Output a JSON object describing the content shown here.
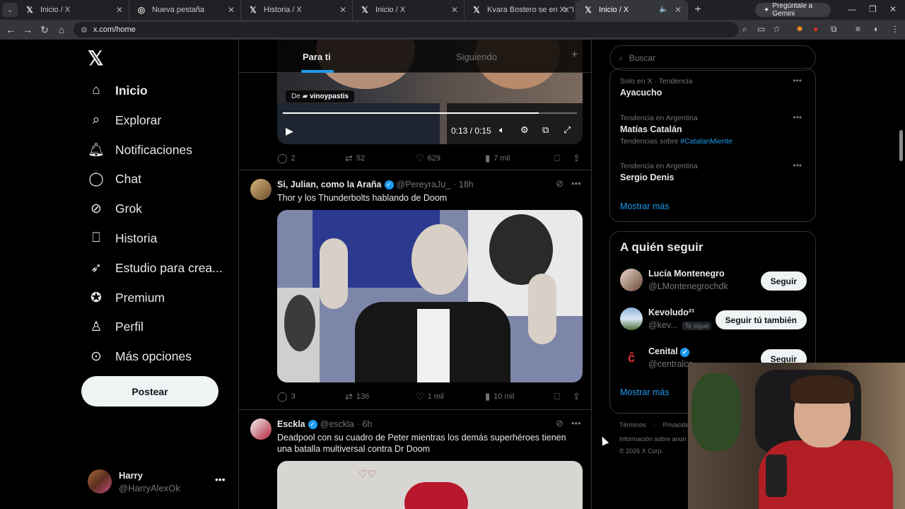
{
  "browser": {
    "tabs": [
      {
        "title": "Inicio / X",
        "favicon": "x-icon"
      },
      {
        "title": "Nueva pestaña",
        "favicon": "chrome-icon"
      },
      {
        "title": "Historia / X",
        "favicon": "x-icon"
      },
      {
        "title": "Inicio / X",
        "favicon": "x-icon"
      },
      {
        "title": "Kvara Bostero se en X: \"Doom d",
        "favicon": "x-icon"
      },
      {
        "title": "Inicio / X",
        "favicon": "x-icon",
        "active": true
      }
    ],
    "gemini_label": "Pregúntale a Gemini",
    "url": "x.com/home"
  },
  "sidebar": {
    "items": [
      {
        "label": "Inicio",
        "icon": "home-icon",
        "active": true
      },
      {
        "label": "Explorar",
        "icon": "search-icon"
      },
      {
        "label": "Notificaciones",
        "icon": "bell-icon"
      },
      {
        "label": "Chat",
        "icon": "chat-icon"
      },
      {
        "label": "Grok",
        "icon": "grok-icon"
      },
      {
        "label": "Historia",
        "icon": "bookmark-icon"
      },
      {
        "label": "Estudio para crea...",
        "icon": "rocket-icon"
      },
      {
        "label": "Premium",
        "icon": "premium-icon"
      },
      {
        "label": "Perfil",
        "icon": "person-icon"
      },
      {
        "label": "Más opciones",
        "icon": "more-circle-icon"
      }
    ],
    "post_button": "Postear",
    "profile": {
      "name": "Harry",
      "handle": "@HarryAlexOk"
    }
  },
  "feed": {
    "tabs": [
      "Para ti",
      "Siguiendo"
    ],
    "video": {
      "via_prefix": "De",
      "via_user": "vinoypastis",
      "time": "0:13 / 0:15",
      "progress": 0.87
    },
    "tweet1_actions": {
      "replies": "2",
      "reposts": "52",
      "likes": "629",
      "views": "7 mil"
    },
    "tweet2": {
      "name": "Si, Julian, como la Araña",
      "handle": "@PereyraJu_",
      "time": "· 18h",
      "text": "Thor y los Thunderbolts hablando de Doom",
      "actions": {
        "replies": "3",
        "reposts": "136",
        "likes": "1 mil",
        "views": "10 mil"
      }
    },
    "tweet3": {
      "name": "Esckla",
      "handle": "@esckla",
      "time": "· 6h",
      "text": "Deadpool con su cuadro de Peter mientras los demás superhéroes tienen una batalla multiversal contra Dr Doom"
    }
  },
  "right": {
    "search_placeholder": "Buscar",
    "trends": [
      {
        "context": "Solo en X · Tendencia",
        "title": "Ayacucho",
        "sub": ""
      },
      {
        "context": "Tendencia en Argentina",
        "title": "Matías Catalán",
        "sub_prefix": "Tendencias sobre",
        "sub_tag": "#CatalanMiente"
      },
      {
        "context": "Tendencia en Argentina",
        "title": "Sergio Denis",
        "sub": ""
      }
    ],
    "show_more": "Mostrar más",
    "who_to_follow": {
      "title": "A quién seguir",
      "accounts": [
        {
          "name": "Lucía Montenegro",
          "handle": "@LMontenegrochdk",
          "button": "Seguir"
        },
        {
          "name": "Kevoludo²¹",
          "handle": "@kev...",
          "badge": "Te sigue",
          "button": "Seguir tú también"
        },
        {
          "name": "Cenital",
          "handle": "@centralco",
          "button": "Seguir",
          "verified": true
        }
      ],
      "show_more": "Mostrar más"
    },
    "footer": {
      "links": [
        "Términos",
        "·",
        "Privacidad"
      ],
      "ads": "Información sobre anun",
      "copyright": "© 2026 X Corp."
    }
  },
  "colors": {
    "accent": "#1d9bf0",
    "bg": "#000000",
    "border": "#2f3336",
    "muted": "#71767b"
  }
}
